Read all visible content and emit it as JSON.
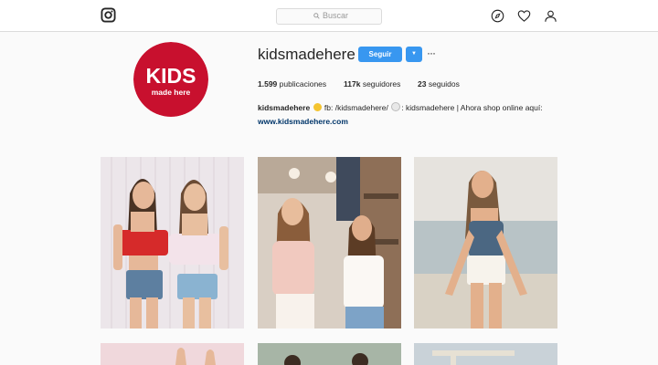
{
  "nav": {
    "search_placeholder": "Buscar"
  },
  "profile": {
    "avatar_text_main": "KIDS",
    "avatar_text_sub": "made here",
    "username": "kidsmadehere",
    "follow_label": "Seguir",
    "dropdown_glyph": "▼",
    "more_glyph": "···",
    "stats": {
      "posts_count": "1.599",
      "posts_label": "publicaciones",
      "followers_count": "117k",
      "followers_label": "seguidores",
      "following_count": "23",
      "following_label": "seguidos"
    },
    "bio": {
      "name": "kidsmadehere",
      "part1": "fb: /kidsmadehere/",
      "part2": ": kidsmadehere | Ahora shop online aquí:"
    },
    "website": "www.kidsmadehere.com"
  },
  "colors": {
    "brand_red": "#c8102e",
    "follow_blue": "#3897f0",
    "link": "#003569"
  },
  "icons": [
    "instagram-icon",
    "search-icon",
    "compass-icon",
    "heart-icon",
    "user-icon"
  ]
}
